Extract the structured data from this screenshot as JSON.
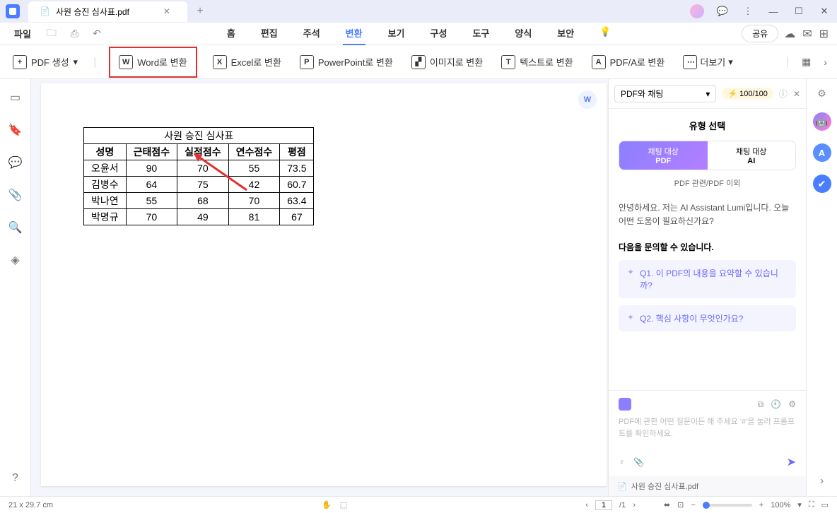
{
  "tab": {
    "title": "사원 승진 심사표.pdf",
    "close": "✕",
    "new": "+"
  },
  "window": {
    "min": "—",
    "max": "☐",
    "close": "✕",
    "chat": "💬",
    "more": "⋮"
  },
  "menu": {
    "file": "파일",
    "items": [
      "홈",
      "편집",
      "주석",
      "변환",
      "보기",
      "구성",
      "도구",
      "양식",
      "보안"
    ],
    "active_idx": 3,
    "share": "공유"
  },
  "ribbon": {
    "create": "PDF 생성",
    "word": "Word로 변환",
    "excel": "Excel로 변환",
    "ppt": "PowerPoint로 변환",
    "image": "이미지로 변환",
    "text": "텍스트로 변환",
    "pdfa": "PDF/A로 변환",
    "more": "더보기"
  },
  "chart_data": {
    "type": "table",
    "title": "사원 승진 심사표",
    "headers": [
      "성명",
      "근태점수",
      "실적점수",
      "연수점수",
      "평점"
    ],
    "rows": [
      [
        "오윤서",
        "90",
        "70",
        "55",
        "73.5"
      ],
      [
        "김병수",
        "64",
        "75",
        "42",
        "60.7"
      ],
      [
        "박나연",
        "55",
        "68",
        "70",
        "63.4"
      ],
      [
        "박명규",
        "70",
        "49",
        "81",
        "67"
      ]
    ]
  },
  "ai": {
    "select": "PDF와 채팅",
    "credit": "100/100",
    "type_title": "유형 선택",
    "seg_left_top": "채팅 대상",
    "seg_left_bot": "PDF",
    "seg_right_top": "채팅 대상",
    "seg_right_bot": "AI",
    "sub": "PDF 관련/PDF 이외",
    "greeting": "안녕하세요. 저는 AI Assistant Lumi입니다. 오늘 어떤 도움이 필요하신가요?",
    "suggest_title": "다음을 문의할 수 있습니다.",
    "q1": "Q1. 이 PDF의 내용을 요약할 수 있습니까?",
    "q2": "Q2. 핵심 사항이 무엇인가요?",
    "prompt": "PDF에 관한 어떤 질문이든 해 주세요 '#'을 눌러 프롬프트를 확인하세요.",
    "attach": "사원 승진 심사표.pdf"
  },
  "status": {
    "dim": "21 x 29.7 cm",
    "page_cur": "1",
    "page_total": "/1",
    "zoom": "100%"
  }
}
